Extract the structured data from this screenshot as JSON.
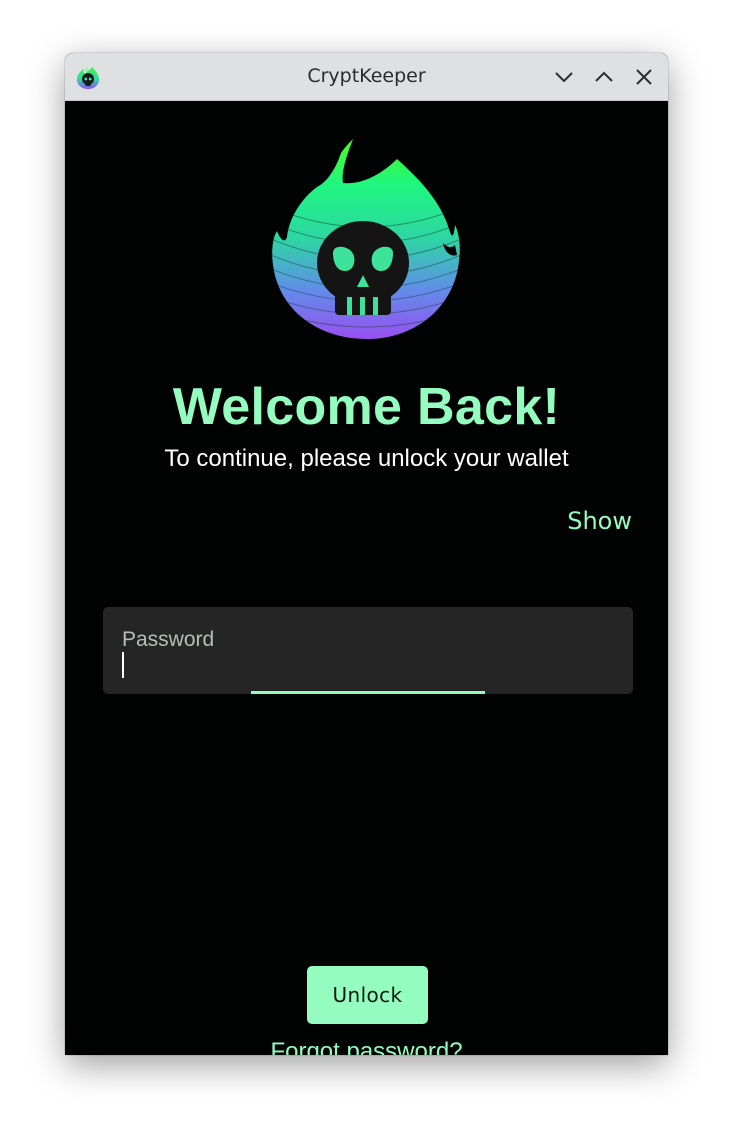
{
  "window": {
    "title": "CryptKeeper",
    "icon": "cryptkeeper-logo-icon"
  },
  "controls": {
    "minimize_icon": "chevron-down-icon",
    "maximize_icon": "chevron-up-icon",
    "close_icon": "close-icon"
  },
  "login": {
    "logo_icon": "flaming-skull-logo",
    "headline": "Welcome Back!",
    "subtitle": "To continue, please unlock your wallet",
    "show_label": "Show",
    "password_label": "Password",
    "password_value": "",
    "unlock_label": "Unlock",
    "forgot_label": "Forgot password?"
  },
  "colors": {
    "accent": "#93fcbe",
    "background": "#000302",
    "field_background": "#252525",
    "titlebar": "#dee0e2"
  }
}
